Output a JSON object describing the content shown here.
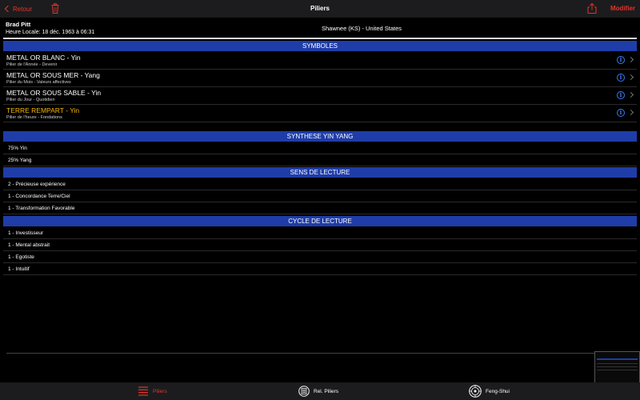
{
  "nav": {
    "back_label": "Retour",
    "title": "Piliers",
    "edit_label": "Modifier"
  },
  "header": {
    "name": "Brad Pitt",
    "local_time": "Heure Locale: 18 déc. 1963 à 06:31",
    "location": "Shawnee (KS) - United States"
  },
  "sections": {
    "symboles": "SYMBOLES",
    "synthese": "SYNTHESE YIN YANG",
    "sens": "SENS DE LECTURE",
    "cycle": "CYCLE DE LECTURE"
  },
  "pillars": [
    {
      "title": "METAL OR BLANC - Yin",
      "subtitle": "Pilier de l'Année - Devenir",
      "color": "#ffffff"
    },
    {
      "title": "METAL OR SOUS MER - Yang",
      "subtitle": "Pilier du Mois - Valeurs affectives",
      "color": "#ffffff"
    },
    {
      "title": "METAL OR SOUS SABLE - Yin",
      "subtitle": "Pilier du Jour - Quotidien",
      "color": "#ffffff"
    },
    {
      "title": "TERRE REMPART - Yin",
      "subtitle": "Pilier de l'heure - Fondations",
      "color": "#f5b800"
    }
  ],
  "synthese": [
    "75% Yin",
    "25% Yang"
  ],
  "sens": [
    "2 - Précieuse expérience",
    "1 - Concordance Terre/Ciel",
    "1 - Transformation Favorable"
  ],
  "cycle": [
    "1 - Investisseur",
    "1 - Mental abstrait",
    "1 - Egotiste",
    "1 - Intuitif"
  ],
  "tabs": [
    {
      "label": "Piliers",
      "icon": "list-icon",
      "active": true
    },
    {
      "label": "Rel. Piliers",
      "icon": "pillars-relation-icon",
      "active": false
    },
    {
      "label": "Feng-Shui",
      "icon": "compass-icon",
      "active": false
    }
  ],
  "colors": {
    "accent": "#e0352b",
    "section_bg": "#1f3da8",
    "highlight": "#f5b800",
    "info_blue": "#3a7bf0"
  }
}
